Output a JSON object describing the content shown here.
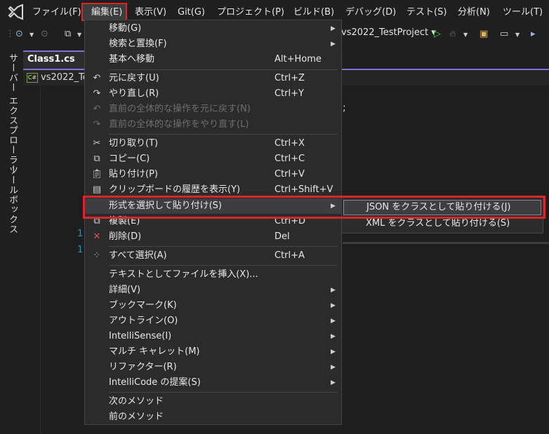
{
  "menubar": {
    "items": [
      {
        "label": "ファイル(F)"
      },
      {
        "label": "編集(E)"
      },
      {
        "label": "表示(V)"
      },
      {
        "label": "Git(G)"
      },
      {
        "label": "プロジェクト(P)"
      },
      {
        "label": "ビルド(B)"
      },
      {
        "label": "デバッグ(D)"
      },
      {
        "label": "テスト(S)"
      },
      {
        "label": "分析(N)"
      },
      {
        "label": "ツール(T)"
      }
    ]
  },
  "toolbar": {
    "project": "vs2022_TestProject ▾"
  },
  "leftstrip": {
    "server_explorer": "サーバー エクスプローラー",
    "toolbox": "ツールボックス"
  },
  "editor": {
    "tab_label": "Class1.cs",
    "tab_pin": "⊕",
    "nav_project": "vs2022_Tes",
    "line_numbers": [
      "1",
      "1"
    ],
    "code_fragment": ";"
  },
  "edit_menu": {
    "items": [
      {
        "label": "移動(G)",
        "shortcut": "",
        "submenu": true
      },
      {
        "label": "検索と置換(F)",
        "shortcut": "",
        "submenu": true
      },
      {
        "label": "基本へ移動",
        "shortcut": "Alt+Home"
      },
      {
        "label": "元に戻す(U)",
        "shortcut": "Ctrl+Z",
        "icon": "undo-icon"
      },
      {
        "label": "やり直し(R)",
        "shortcut": "Ctrl+Y",
        "icon": "redo-icon"
      },
      {
        "label": "直前の全体的な操作を元に戻す(N)",
        "shortcut": "",
        "disabled": true
      },
      {
        "label": "直前の全体的な操作をやり直す(L)",
        "shortcut": "",
        "disabled": true
      },
      {
        "label": "切り取り(T)",
        "shortcut": "Ctrl+X",
        "icon": "cut-icon"
      },
      {
        "label": "コピー(C)",
        "shortcut": "Ctrl+C",
        "icon": "copy-icon"
      },
      {
        "label": "貼り付け(P)",
        "shortcut": "Ctrl+V",
        "icon": "paste-icon"
      },
      {
        "label": "クリップボードの履歴を表示(Y)",
        "shortcut": "Ctrl+Shift+V",
        "icon": "clipboard-history-icon"
      },
      {
        "label": "形式を選択して貼り付け(S)",
        "shortcut": "",
        "submenu": true
      },
      {
        "label": "複製(E)",
        "shortcut": "Ctrl+D",
        "icon": "duplicate-icon"
      },
      {
        "label": "削除(D)",
        "shortcut": "Del",
        "icon": "delete-icon"
      },
      {
        "label": "すべて選択(A)",
        "shortcut": "Ctrl+A",
        "icon": "select-all-icon"
      },
      {
        "label": "テキストとしてファイルを挿入(X)...",
        "shortcut": ""
      },
      {
        "label": "詳細(V)",
        "shortcut": "",
        "submenu": true
      },
      {
        "label": "ブックマーク(K)",
        "shortcut": "",
        "submenu": true
      },
      {
        "label": "アウトライン(O)",
        "shortcut": "",
        "submenu": true
      },
      {
        "label": "IntelliSense(I)",
        "shortcut": "",
        "submenu": true
      },
      {
        "label": "マルチ キャレット(M)",
        "shortcut": "",
        "submenu": true
      },
      {
        "label": "リファクター(R)",
        "shortcut": "",
        "submenu": true
      },
      {
        "label": "IntelliCode の提案(S)",
        "shortcut": "",
        "submenu": true
      },
      {
        "label": "次のメソッド",
        "shortcut": ""
      },
      {
        "label": "前のメソッド",
        "shortcut": ""
      }
    ]
  },
  "paste_special_submenu": {
    "items": [
      {
        "label": "JSON をクラスとして貼り付ける(J)"
      },
      {
        "label": "XML をクラスとして貼り付ける(S)"
      }
    ]
  },
  "colors": {
    "highlight_red": "#d9262c",
    "accent_purple": "#7e73d6",
    "menu_bg": "#2b2b2b"
  }
}
